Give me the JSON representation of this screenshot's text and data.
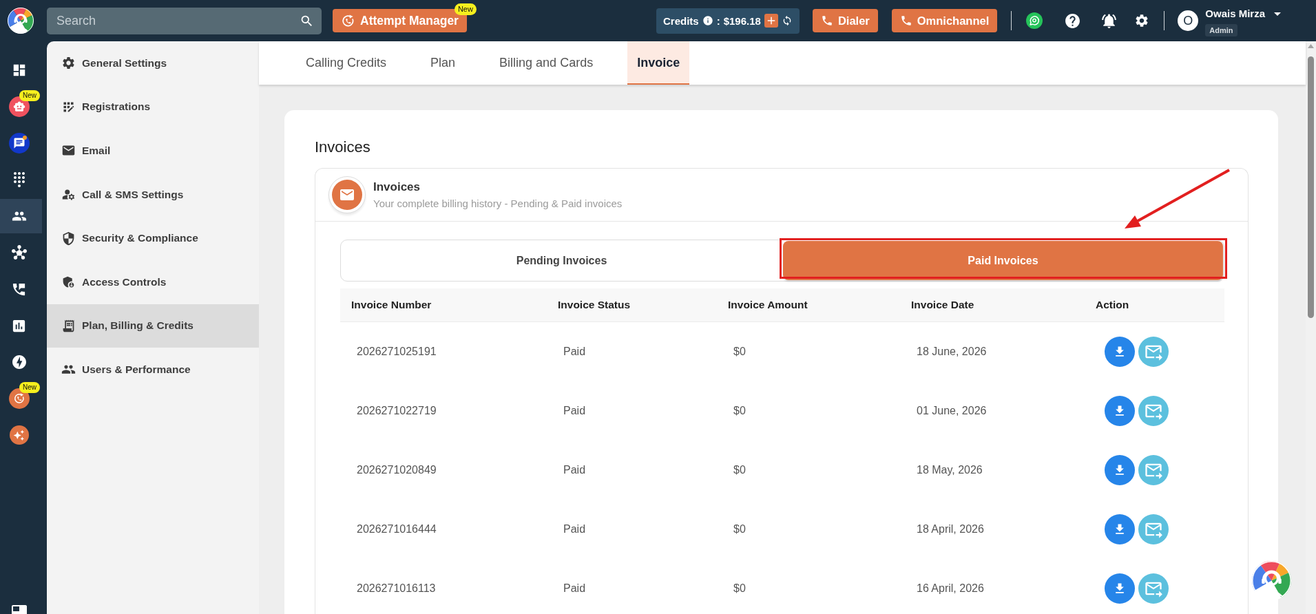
{
  "top_bar": {
    "search": {
      "placeholder": "Search"
    },
    "attempt_manager": {
      "label": "Attempt Manager",
      "badge": "New"
    },
    "credits": {
      "label": "Credits",
      "separator": ":",
      "amount": "$196.18"
    },
    "buttons": [
      {
        "label": "Dialer"
      },
      {
        "label": "Omnichannel"
      }
    ],
    "user": {
      "initial": "O",
      "name": "Owais Mirza",
      "role": "Admin"
    }
  },
  "icon_rail": [
    {
      "kind": "dashboard",
      "selected": false
    },
    {
      "kind": "bot",
      "badge": "New",
      "selected": false
    },
    {
      "kind": "chat",
      "selected": false
    },
    {
      "kind": "dialpad",
      "selected": false
    },
    {
      "kind": "users",
      "selected": true
    },
    {
      "kind": "hub",
      "selected": false
    },
    {
      "kind": "phone_message",
      "selected": false
    },
    {
      "kind": "report",
      "selected": false
    },
    {
      "kind": "bolt",
      "selected": false
    },
    {
      "kind": "attempt",
      "badge": "New",
      "selected": false
    },
    {
      "kind": "sparkle",
      "selected": false
    }
  ],
  "settings_menu": [
    {
      "kind": "gear",
      "label": "General Settings",
      "selected": false
    },
    {
      "kind": "registration",
      "label": "Registrations",
      "selected": false
    },
    {
      "kind": "mail",
      "label": "Email",
      "selected": false
    },
    {
      "kind": "user_gear",
      "label": "Call & SMS Settings",
      "selected": false
    },
    {
      "kind": "shield",
      "label": "Security & Compliance",
      "selected": false
    },
    {
      "kind": "admin",
      "label": "Access Controls",
      "selected": false
    },
    {
      "kind": "receipt",
      "label": "Plan, Billing & Credits",
      "selected": true
    },
    {
      "kind": "people",
      "label": "Users & Performance",
      "selected": false
    }
  ],
  "tabs": [
    {
      "label": "Calling Credits",
      "selected": false
    },
    {
      "label": "Plan",
      "selected": false
    },
    {
      "label": "Billing and Cards",
      "selected": false
    },
    {
      "label": "Invoice",
      "selected": true
    }
  ],
  "invoices": {
    "title": "Invoices",
    "panel": {
      "title": "Invoices",
      "subtitle": "Your complete billing history - Pending & Paid invoices"
    },
    "toggle": [
      {
        "label": "Pending Invoices",
        "selected": false
      },
      {
        "label": "Paid Invoices",
        "selected": true
      }
    ],
    "table": {
      "columns": [
        "Invoice Number",
        "Invoice Status",
        "Invoice Amount",
        "Invoice Date",
        "Action"
      ],
      "rows": [
        {
          "invoice_number": "2026271025191",
          "status": "Paid",
          "amount": "$0",
          "date": "18 June, 2026"
        },
        {
          "invoice_number": "2026271022719",
          "status": "Paid",
          "amount": "$0",
          "date": "01 June, 2026"
        },
        {
          "invoice_number": "2026271020849",
          "status": "Paid",
          "amount": "$0",
          "date": "18 May, 2026"
        },
        {
          "invoice_number": "2026271016444",
          "status": "Paid",
          "amount": "$0",
          "date": "18 April, 2026"
        },
        {
          "invoice_number": "2026271016113",
          "status": "Paid",
          "amount": "$0",
          "date": "16 April, 2026"
        }
      ]
    }
  }
}
